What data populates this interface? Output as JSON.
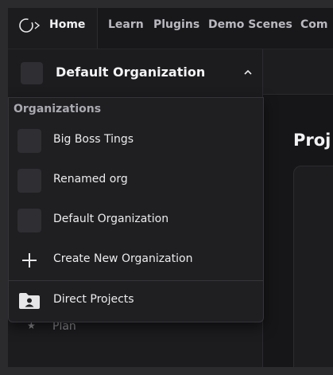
{
  "topbar": {
    "home_label": "Home",
    "nav": [
      "Learn",
      "Plugins",
      "Demo Scenes",
      "Com"
    ]
  },
  "sidebar": {
    "org_name": "Default Organization",
    "hidden_item_label": "Plan"
  },
  "main": {
    "title": "Proj"
  },
  "dropdown": {
    "heading": "Organizations",
    "orgs": [
      "Big Boss Tings",
      "Renamed org",
      "Default Organization"
    ],
    "create_label": "Create New Organization",
    "direct_projects_label": "Direct Projects"
  },
  "colors": {
    "background": "#141416",
    "panel": "#1f1f22",
    "avatar": "#2e2e33",
    "text": "#ececef",
    "muted": "#a9a9b0"
  },
  "icons": [
    "logo-icon",
    "chevron-up-icon",
    "plus-icon",
    "folder-user-icon",
    "star-icon"
  ]
}
